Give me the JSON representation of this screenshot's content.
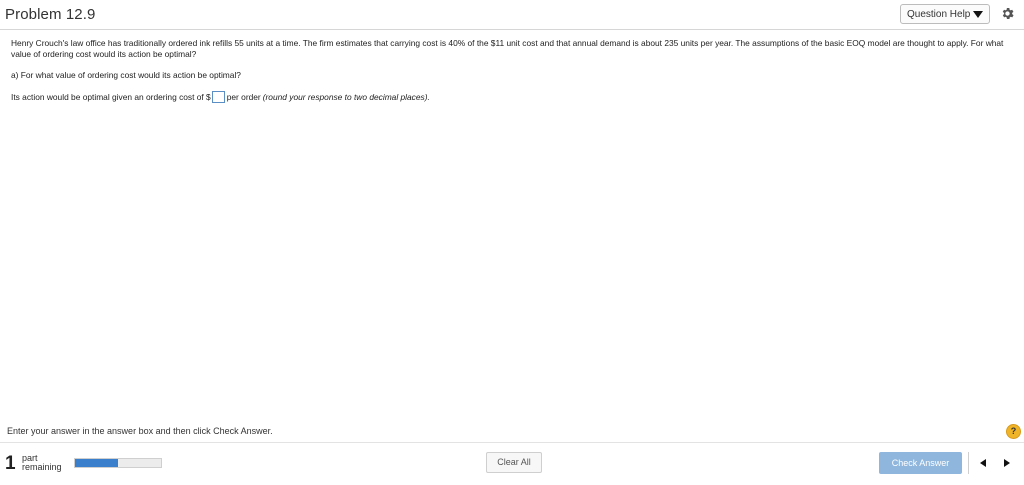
{
  "header": {
    "title": "Problem 12.9",
    "question_help_label": "Question Help"
  },
  "problem": {
    "text": "Henry Crouch's law office has traditionally ordered ink refills 55 units at a time. The firm estimates that carrying cost is 40% of the $11 unit cost and that annual demand is about 235 units per year. The assumptions of the basic EOQ model are thought to apply. For what value of ordering cost would its action be optimal?",
    "part_a_question": "a) For what value of ordering cost would its action be optimal?",
    "answer_prefix": "Its action would be optimal given an ordering cost of $",
    "answer_value": "",
    "answer_suffix": "per order",
    "answer_hint": "(round your response to two decimal places)."
  },
  "footer": {
    "instruction": "Enter your answer in the answer box and then click Check Answer.",
    "help_symbol": "?",
    "parts_remaining_count": "1",
    "parts_remaining_label_1": "part",
    "parts_remaining_label_2": "remaining",
    "progress_fraction": 0.5,
    "clear_all_label": "Clear All",
    "check_answer_label": "Check Answer"
  },
  "colors": {
    "progress_fill": "#3a7fcb",
    "check_button": "#8fb6dd",
    "help_circle": "#f0b429"
  }
}
